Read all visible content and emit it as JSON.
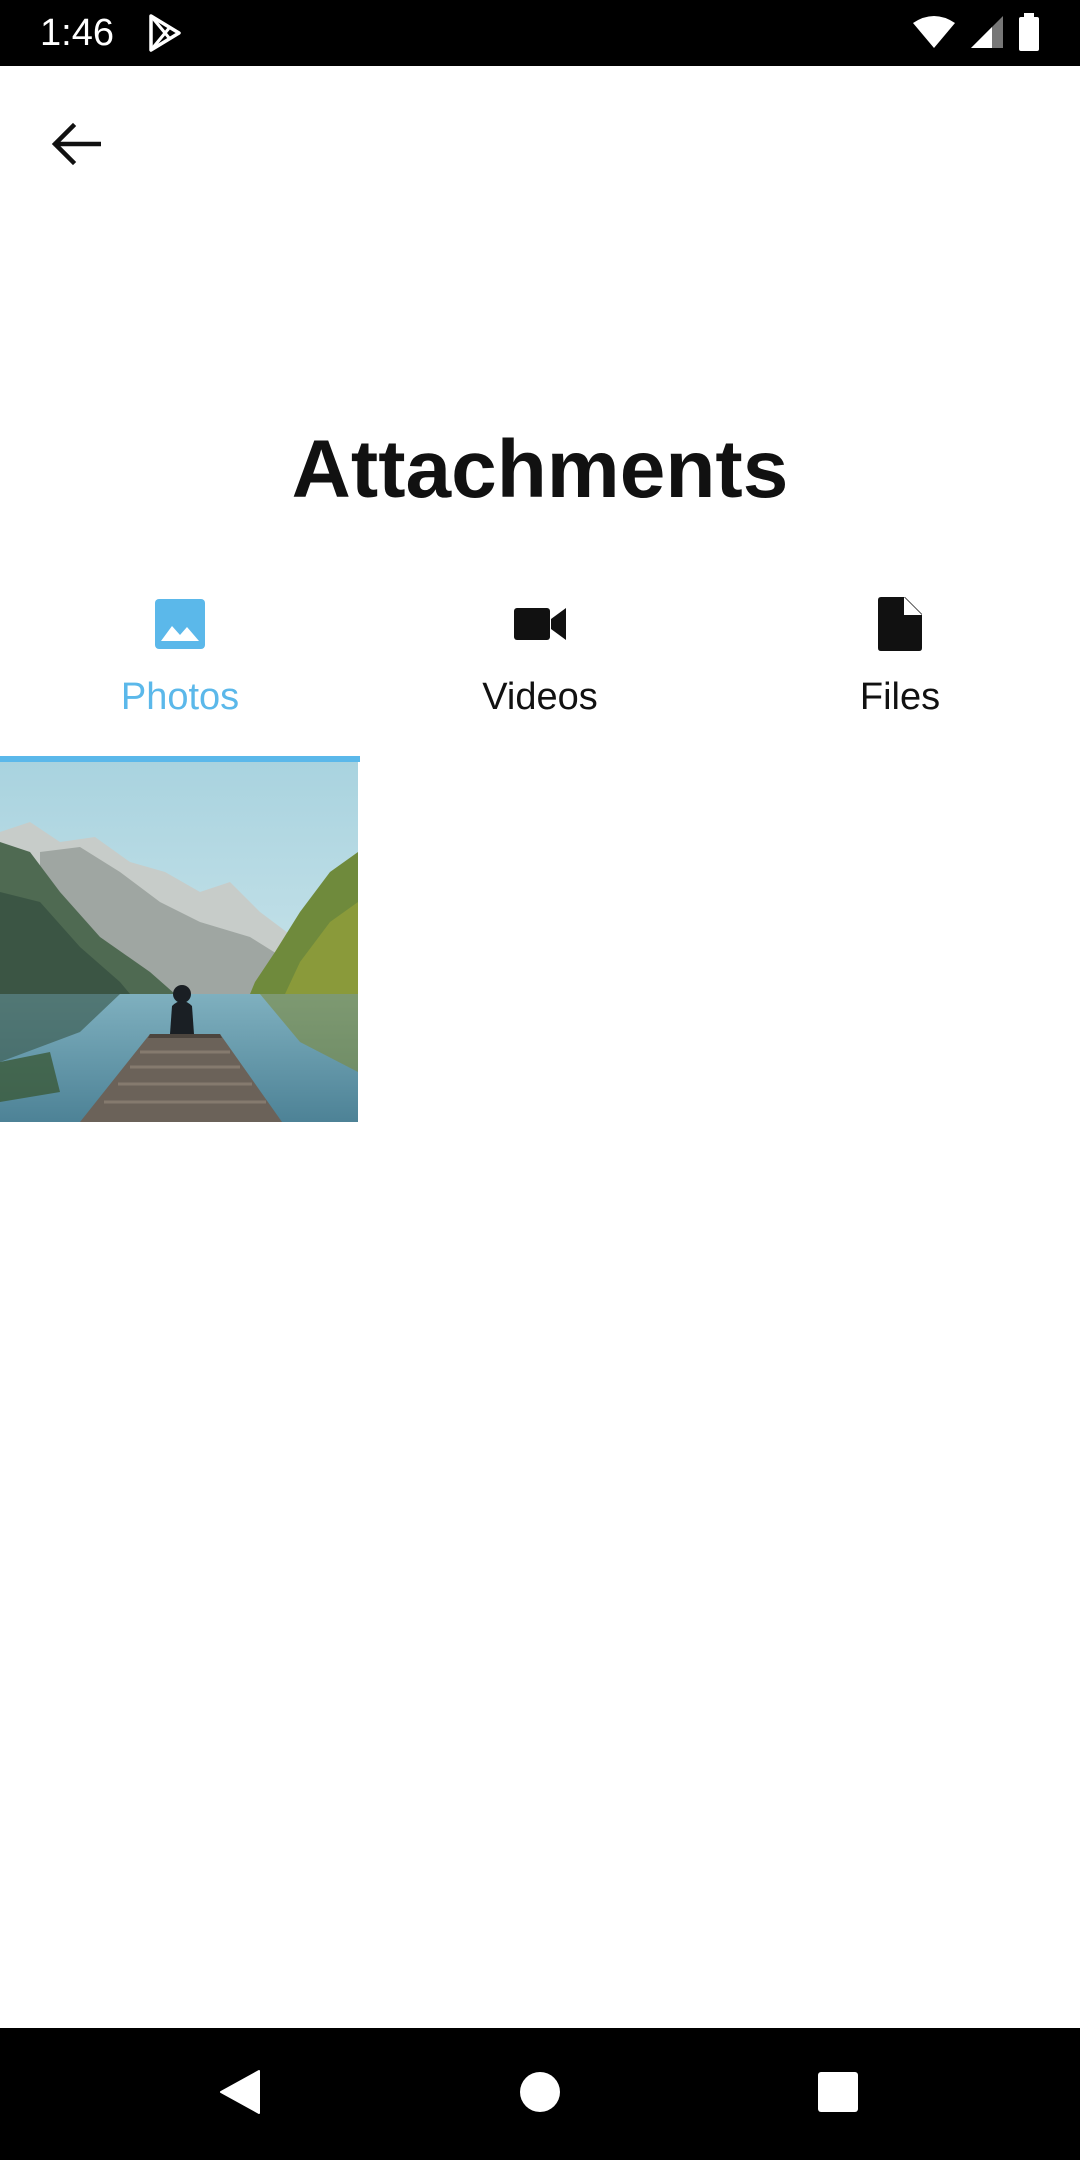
{
  "status_bar": {
    "time": "1:46",
    "icons": [
      "play-store-icon",
      "wifi-icon",
      "cell-signal-icon",
      "battery-icon"
    ]
  },
  "app_bar": {
    "back_icon": "arrow-back-icon"
  },
  "page": {
    "title": "Attachments"
  },
  "tabs": [
    {
      "label": "Photos",
      "icon": "image-icon",
      "active": true
    },
    {
      "label": "Videos",
      "icon": "videocam-icon",
      "active": false
    },
    {
      "label": "Files",
      "icon": "file-icon",
      "active": false
    }
  ],
  "photos": [
    {
      "subject": "person sitting on a wooden pier facing a mountain lake"
    }
  ],
  "colors": {
    "accent": "#5bb8ea",
    "text": "#111111",
    "system_bars": "#000000"
  },
  "nav_bar": {
    "buttons": [
      "back-triangle-icon",
      "home-circle-icon",
      "recents-square-icon"
    ]
  }
}
